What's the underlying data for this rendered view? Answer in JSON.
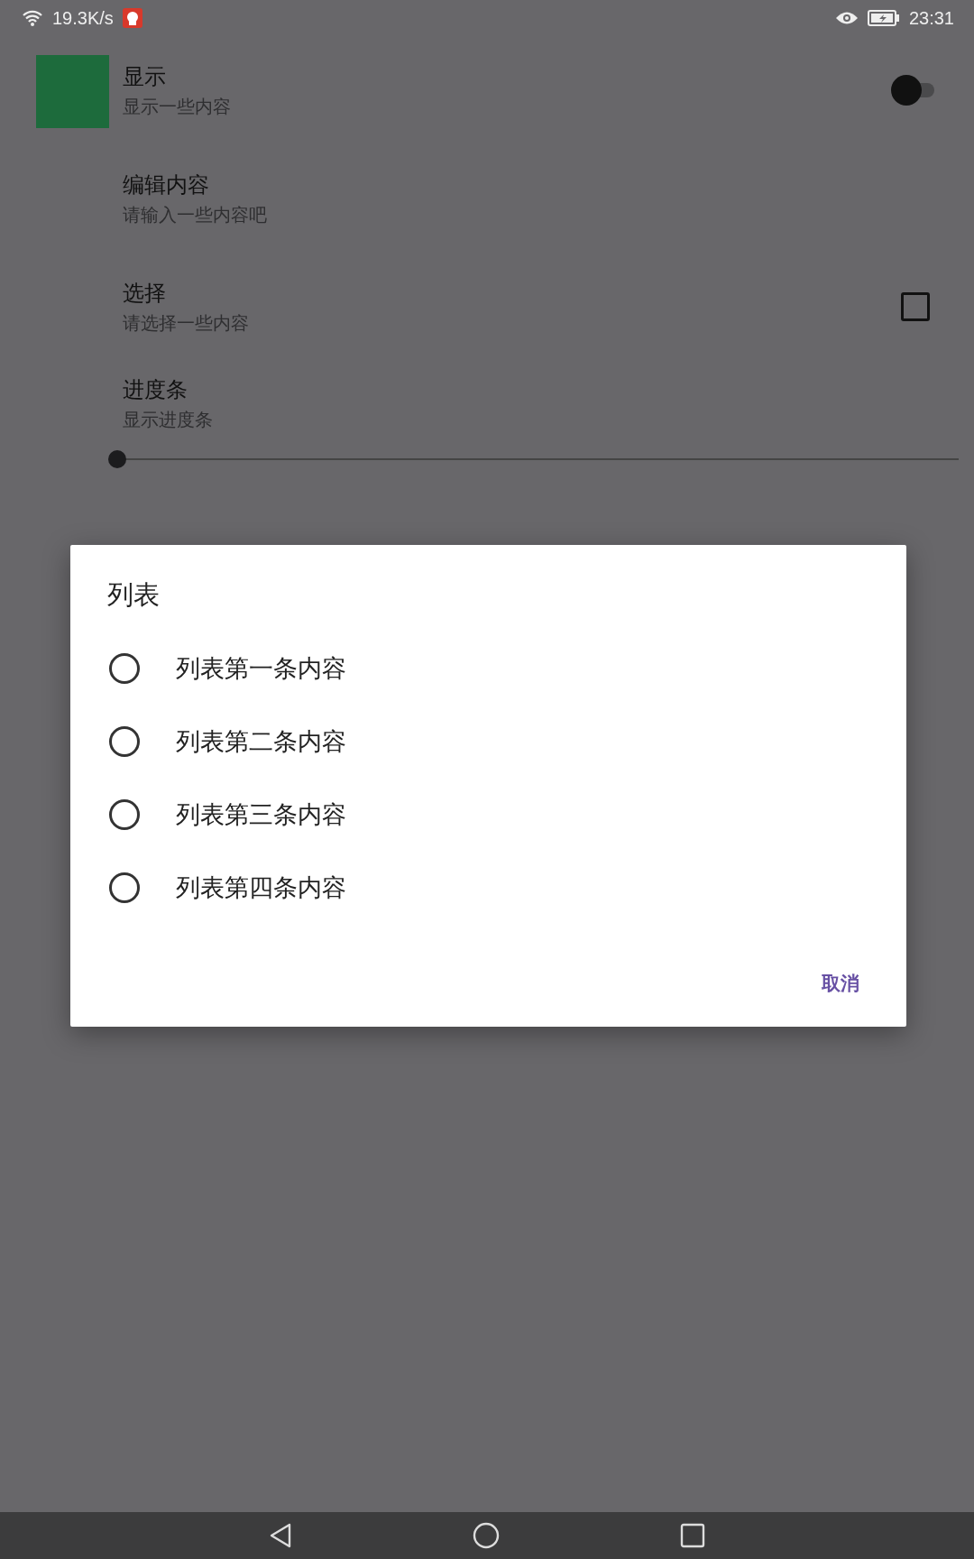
{
  "status_bar": {
    "network_speed": "19.3K/s",
    "time": "23:31"
  },
  "settings": [
    {
      "kind": "switch",
      "title": "显示",
      "summary": "显示一些内容",
      "on": false
    },
    {
      "kind": "text",
      "title": "编辑内容",
      "summary": "请输入一些内容吧"
    },
    {
      "kind": "checkbox",
      "title": "选择",
      "summary": "请选择一些内容",
      "checked": false
    },
    {
      "kind": "slider",
      "title": "进度条",
      "summary": "显示进度条",
      "level": 0
    }
  ],
  "dialog": {
    "title": "列表",
    "options": [
      {
        "label": "列表第一条内容",
        "selected": false
      },
      {
        "label": "列表第二条内容",
        "selected": false
      },
      {
        "label": "列表第三条内容",
        "selected": false
      },
      {
        "label": "列表第四条内容",
        "selected": false
      }
    ],
    "buttons": [
      "取消"
    ]
  }
}
